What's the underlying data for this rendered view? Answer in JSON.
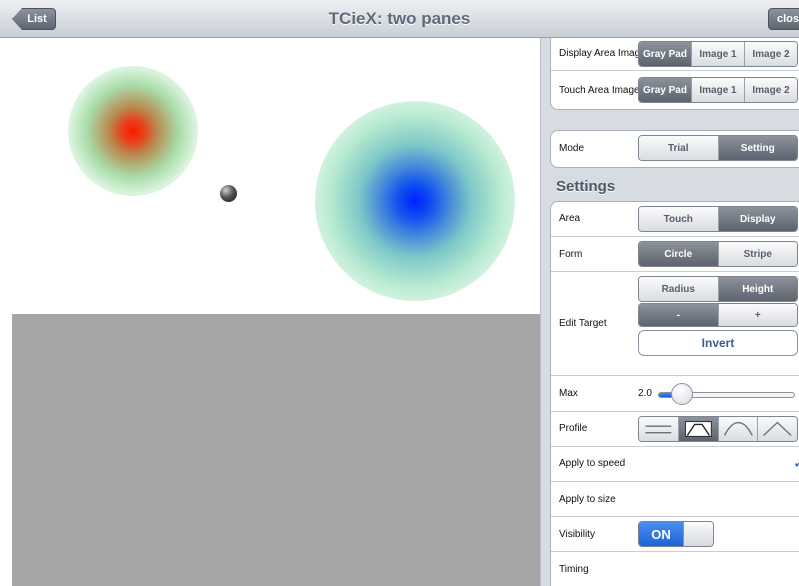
{
  "navbar": {
    "title": "TCieX: two panes",
    "back_label": "List",
    "close_label": "close"
  },
  "image_selection": {
    "display_label": "Display Area Image",
    "touch_label": "Touch Area Image",
    "options": [
      "Gray Pad",
      "Image 1",
      "Image 2"
    ],
    "display_selected": "Gray Pad",
    "touch_selected": "Gray Pad"
  },
  "mode": {
    "label": "Mode",
    "options": [
      "Trial",
      "Setting"
    ],
    "selected": "Setting"
  },
  "settings": {
    "title": "Settings",
    "area": {
      "label": "Area",
      "options": [
        "Touch",
        "Display"
      ],
      "selected": "Display"
    },
    "form": {
      "label": "Form",
      "options": [
        "Circle",
        "Stripe"
      ],
      "selected": "Circle"
    },
    "edit_target": {
      "label": "Edit Target",
      "options": [
        "Radius",
        "Height"
      ],
      "selected": "Height",
      "minus": "-",
      "plus": "+",
      "invert": "Invert"
    },
    "max": {
      "label": "Max",
      "value_text": "2.0",
      "level": 0.15
    },
    "profile": {
      "label": "Profile",
      "icons": [
        "flat-profile-icon",
        "trapezoid-profile-icon",
        "bell-profile-icon",
        "triangle-profile-icon"
      ],
      "selected_index": 1
    },
    "apply_speed": {
      "label": "Apply to speed",
      "checked": true
    },
    "apply_size": {
      "label": "Apply to size",
      "checked": false
    },
    "visibility": {
      "label": "Visibility",
      "toggle_text": "ON"
    },
    "timing": {
      "label": "Timing"
    }
  },
  "colors": {
    "accent_blue": "#1d63d8",
    "touch_area_gray": "#a6a6a6",
    "panel_bg": "#d7dbe2"
  }
}
